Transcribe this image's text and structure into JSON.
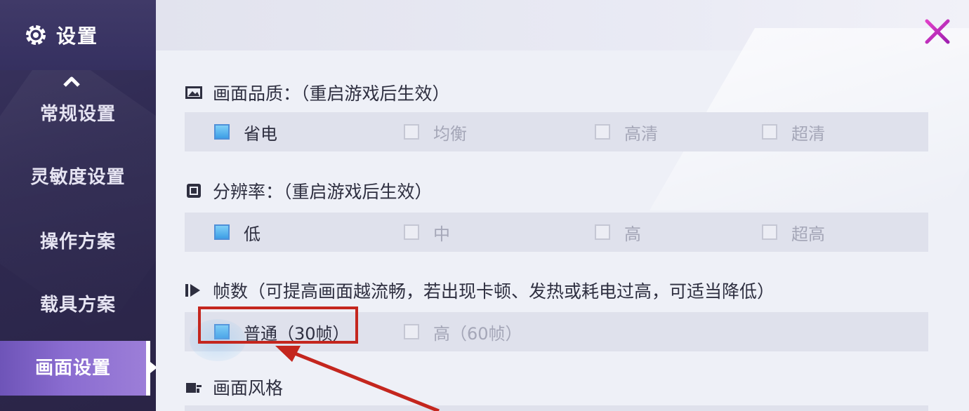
{
  "sidebar": {
    "title": "设置",
    "items": [
      {
        "label": "常规设置",
        "active": false
      },
      {
        "label": "灵敏度设置",
        "active": false
      },
      {
        "label": "操作方案",
        "active": false
      },
      {
        "label": "载具方案",
        "active": false
      },
      {
        "label": "画面设置",
        "active": true
      }
    ]
  },
  "sections": [
    {
      "label": "画面品质：（重启游戏后生效）",
      "options": [
        {
          "label": "省电",
          "selected": true
        },
        {
          "label": "均衡",
          "selected": false
        },
        {
          "label": "高清",
          "selected": false
        },
        {
          "label": "超清",
          "selected": false
        }
      ]
    },
    {
      "label": "分辨率：（重启游戏后生效）",
      "options": [
        {
          "label": "低",
          "selected": true
        },
        {
          "label": "中",
          "selected": false
        },
        {
          "label": "高",
          "selected": false
        },
        {
          "label": "超高",
          "selected": false
        }
      ]
    },
    {
      "label": "帧数（可提高画面越流畅，若出现卡顿、发热或耗电过高，可适当降低）",
      "options": [
        {
          "label": "普通（30帧）",
          "selected": true
        },
        {
          "label": "高（60帧）",
          "selected": false
        }
      ]
    },
    {
      "label": "画面风格",
      "options": []
    }
  ],
  "colors": {
    "accent_purple": "#8a6cd0",
    "checkbox_on": "#3d9ee6",
    "close_magenta": "#c02bb6",
    "annotation_red": "#c4261e"
  }
}
